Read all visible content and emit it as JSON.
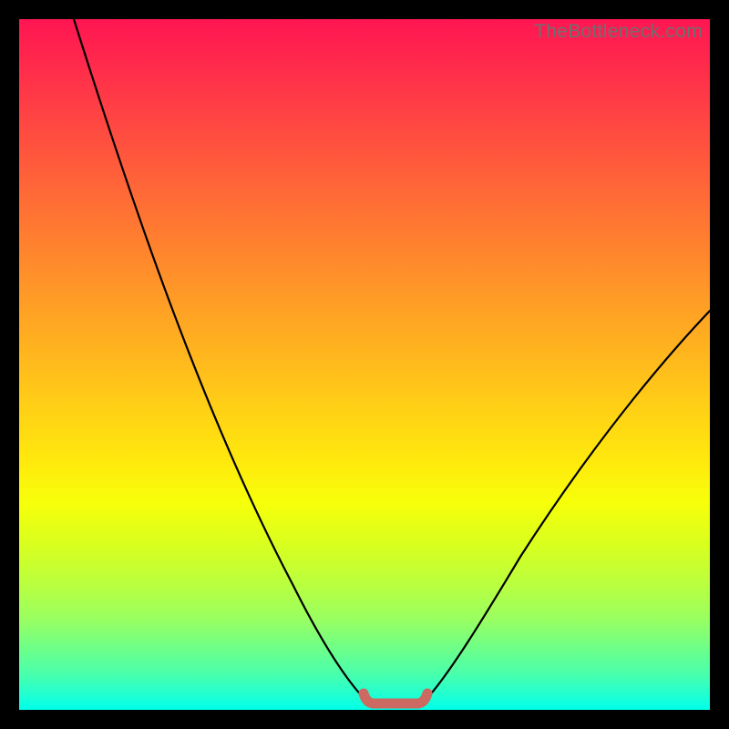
{
  "watermark": "TheBottleneck.com",
  "colors": {
    "frame": "#000000",
    "curve": "#000000",
    "marker": "#cc6960",
    "gradient_top": "#ff1552",
    "gradient_bottom": "#00ffe8"
  },
  "chart_data": {
    "type": "line",
    "title": "",
    "xlabel": "",
    "ylabel": "",
    "xlim": [
      0,
      100
    ],
    "ylim": [
      0,
      100
    ],
    "series": [
      {
        "name": "bottleneck-curve",
        "x": [
          0,
          4,
          8,
          12,
          16,
          20,
          24,
          28,
          32,
          36,
          40,
          44,
          48,
          50,
          52,
          54,
          56,
          58,
          60,
          64,
          68,
          72,
          76,
          80,
          84,
          88,
          92,
          96,
          100
        ],
        "y": [
          100,
          92,
          84,
          76,
          68,
          60,
          52,
          44,
          36,
          28,
          20,
          12,
          4,
          1,
          0,
          0,
          0,
          1,
          4,
          10,
          17,
          24,
          31,
          38,
          44,
          50,
          55,
          59,
          62
        ]
      },
      {
        "name": "optimal-range-marker",
        "x": [
          50,
          52,
          54,
          56,
          58
        ],
        "y": [
          1.2,
          0.4,
          0.3,
          0.4,
          1.2
        ]
      }
    ],
    "grid": false,
    "legend": false
  }
}
